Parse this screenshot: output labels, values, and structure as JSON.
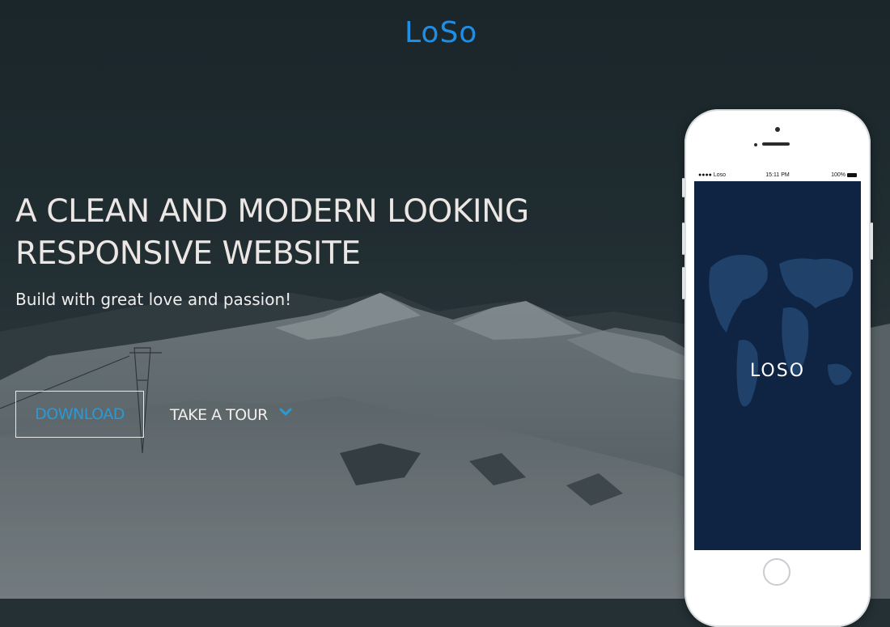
{
  "brand": {
    "logo_text": "LoSo",
    "accent": "#1f8fe6"
  },
  "hero": {
    "headline_line1": "A CLEAN AND MODERN LOOKING",
    "headline_line2": "RESPONSIVE WEBSITE",
    "tagline": "Build with great love and passion!",
    "download_label": "DOWNLOAD",
    "tour_label": "TAKE A TOUR",
    "tour_icon": "chevron-down-icon"
  },
  "phone": {
    "status_carrier": "●●●● Loso",
    "status_time": "15:11 PM",
    "status_battery": "100%",
    "app_logo": "LOSO",
    "screen_color": "#0f2443"
  }
}
